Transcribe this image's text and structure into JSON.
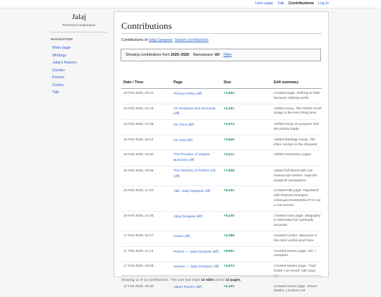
{
  "topbar": {
    "links": [
      {
        "label": "User page",
        "active": false
      },
      {
        "label": "Talk",
        "active": false
      },
      {
        "label": "Contributions",
        "active": true
      },
      {
        "label": "Log in",
        "active": false
      }
    ]
  },
  "sidebar": {
    "site_title": "Jalaj",
    "site_subtitle": "Personal Compendium",
    "nav_heading": "NAVIGATION",
    "items": [
      "Main page",
      "Writings",
      "Jalaj's Razors",
      "Quotes",
      "Poems",
      "Codex",
      "Talk"
    ]
  },
  "main": {
    "title": "Contributions",
    "subline": {
      "prefix": "Contributions of",
      "user": "Jalaj Gangwar",
      "search_link": "Search contributions"
    },
    "filter": {
      "prefix": "Showing contributions from",
      "range": "2025–2026",
      "ns_label": "Namespace:",
      "ns_value": "All",
      "filter_link": "Filter"
    },
    "table": {
      "headers": [
        "Date / Time",
        "Page",
        "Size",
        "Edit summary"
      ],
      "diff_label": "(diff)",
      "rows": [
        {
          "date": "19 Feb 2026, 23:41",
          "page": "Privacy Policy",
          "size": "+1,842",
          "summary": "Created page. Nothing to hide because nothing exists."
        },
        {
          "date": "19 Feb 2026, 22:15",
          "page": "On Shadows and Humanity",
          "size": "+3,201",
          "summary": "Added essay. The infinite scroll image is the best thing here."
        },
        {
          "date": "19 Feb 2026, 21:08",
          "page": "On Telos",
          "size": "+2,874",
          "summary": "Added essay on purpose and the infinite battle."
        },
        {
          "date": "19 Feb 2026, 20:44",
          "page": "On God",
          "size": "+3,540",
          "summary": "Added theology essay. The Eden section is the sharpest."
        },
        {
          "date": "19 Feb 2026, 19:30",
          "page": "The Paradox of Utopian Business",
          "size": "+4,112",
          "summary": "Added economics paper."
        },
        {
          "date": "19 Feb 2026, 18:55",
          "page": "The Paradox of Perfect Life",
          "size": "+7,838",
          "summary": "Added full thesis with raw manuscript section. Kept the marginal annotations."
        },
        {
          "date": "18 Feb 2026, 17:20",
          "page": "Talk: Jalaj Gangwar",
          "size": "+6,441",
          "summary": "Created talk page. Populated with fictional strangers. CleanupCrewMember47 is not a real person."
        },
        {
          "date": "18 Feb 2026, 14:03",
          "page": "Jalaj Gangwar",
          "size": "+5,220",
          "summary": "Created main page. Biography is fabricated but spiritually accurate."
        },
        {
          "date": "17 Feb 2026, 22:47",
          "page": "Codex",
          "size": "+4,388",
          "summary": "Created Codex. Moususis is the most useful word here."
        },
        {
          "date": "17 Feb 2026, 21:14",
          "page": "Poems — Jalaj Gangwar",
          "size": "+8,901",
          "summary": "Created poems page. Vol. I complete."
        },
        {
          "date": "17 Feb 2026, 19:58",
          "page": "Quotes — Jalaj Gangwar",
          "size": "+3,874",
          "summary": "Created quotes page. \"God forbid I am loved\" still stops me."
        },
        {
          "date": "17 Feb 2026, 18:30",
          "page": "Jalaj's Razors",
          "size": "+4,102",
          "summary": "Created razors page. Seven blades. Let them cut."
        }
      ]
    },
    "footer": {
      "showing": "Showing 12 of 12 contributions.",
      "made_prefix": "This user has made",
      "edits": "12 edits",
      "across": "across",
      "pages": "12 pages."
    }
  },
  "colors": {
    "link": "#3366cc",
    "positive_size": "#14866d",
    "panel_bg": "#ffffff",
    "page_bg": "#f6f6f6"
  }
}
